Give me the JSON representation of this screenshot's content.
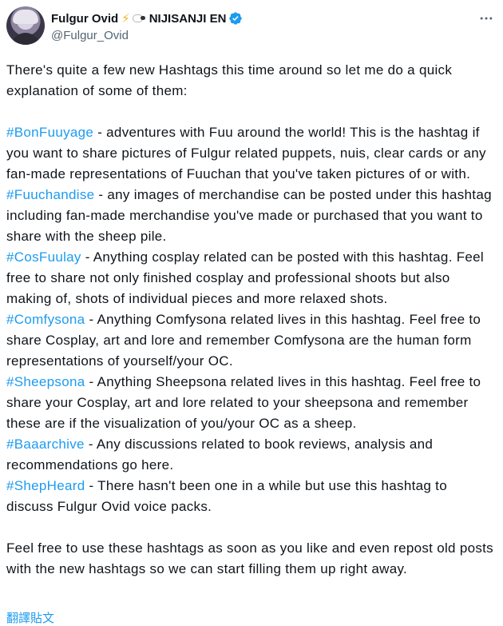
{
  "author": {
    "display_name": "Fulgur Ovid",
    "org": "NIJISANJI EN",
    "handle": "@Fulgur_Ovid",
    "bolt_emoji": "⚡"
  },
  "colors": {
    "link": "#1d9bf0",
    "verified": "#1d9bf0",
    "text": "#0f1419",
    "muted": "#536471"
  },
  "tweet": {
    "intro": "There's quite a few new Hashtags this time around so let me do a quick explanation of some of them:",
    "items": [
      {
        "tag": "#BonFuuyage",
        "text": " - adventures with Fuu around the world! This is the hashtag if you want to share pictures of Fulgur related puppets, nuis, clear cards or any fan-made representations of Fuuchan that you've taken pictures of or with."
      },
      {
        "tag": "#Fuuchandise",
        "text": " - any images of merchandise can be posted under this hashtag including fan-made merchandise you've made or purchased that you want to share with the sheep pile."
      },
      {
        "tag": "#CosFuulay",
        "text": " - Anything cosplay related can be posted with this hashtag. Feel free to share not only finished cosplay and professional shoots but also making of, shots of individual pieces and more relaxed shots."
      },
      {
        "tag": "#Comfysona",
        "text": " - Anything Comfysona related lives in this hashtag. Feel free to share Cosplay, art and lore and remember Comfysona are the human form representations of yourself/your OC."
      },
      {
        "tag": "#Sheepsona",
        "text": " - Anything Sheepsona related lives in this hashtag. Feel free to share your Cosplay, art and lore related to your sheepsona and remember these are if the visualization of you/your OC as a sheep."
      },
      {
        "tag": "#Baaarchive",
        "text": " - Any discussions related to book reviews, analysis and recommendations go here."
      },
      {
        "tag": "#ShepHeard",
        "text": " - There hasn't been one in a while but use this hashtag to discuss Fulgur Ovid voice packs."
      }
    ],
    "outro": "Feel free to use these hashtags as soon as you like and even repost old posts with the new hashtags so we can start filling them up right away.",
    "translate_label": "翻譯貼文"
  }
}
